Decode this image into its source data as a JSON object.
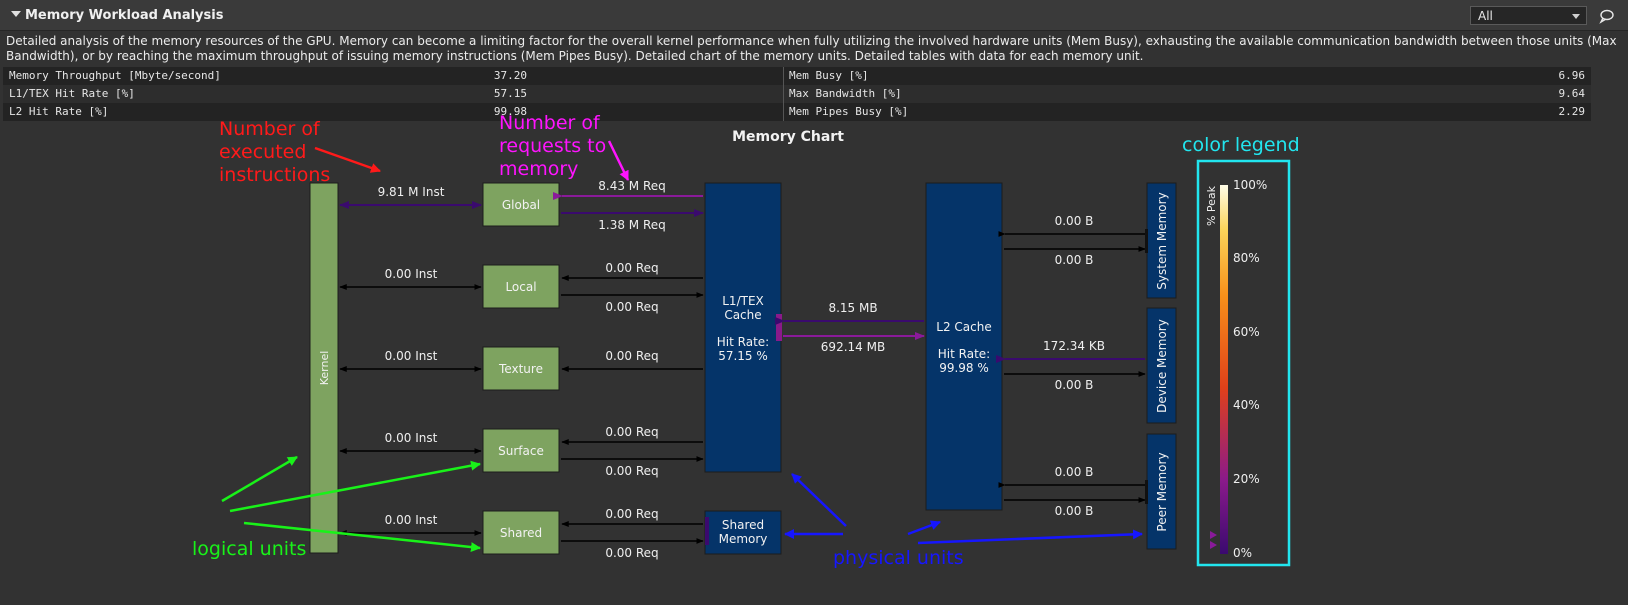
{
  "header": {
    "title": "Memory Workload Analysis",
    "filter_value": "All"
  },
  "description": "Detailed analysis of the memory resources of the GPU. Memory can become a limiting factor for the overall kernel performance when fully utilizing the involved hardware units (Mem Busy), exhausting the available communication bandwidth between those units (Max Bandwidth), or by reaching the maximum throughput of issuing memory instructions (Mem Pipes Busy). Detailed chart of the memory units. Detailed tables with data for each memory unit.",
  "metrics": [
    {
      "left_name": "Memory Throughput [Mbyte/second]",
      "left_value": "37.20",
      "right_name": "Mem Busy [%]",
      "right_value": "6.96"
    },
    {
      "left_name": "L1/TEX Hit Rate [%]",
      "left_value": "57.15",
      "right_name": "Max Bandwidth [%]",
      "right_value": "9.64"
    },
    {
      "left_name": "L2 Hit Rate [%]",
      "left_value": "99.98",
      "right_name": "Mem Pipes Busy [%]",
      "right_value": "2.29"
    }
  ],
  "chart": {
    "title": "Memory Chart",
    "kernel_label": "Kernel",
    "logical_units": [
      "Global",
      "Local",
      "Texture",
      "Surface",
      "Shared"
    ],
    "inst_labels": [
      "9.81 M Inst",
      "0.00 Inst",
      "0.00 Inst",
      "0.00 Inst",
      "0.00 Inst"
    ],
    "req_labels": {
      "global_top": "8.43 M Req",
      "global_bottom": "1.38 M Req",
      "local_top": "0.00 Req",
      "local_bottom": "0.00 Req",
      "texture": "0.00 Req",
      "surface_top": "0.00 Req",
      "surface_bottom": "0.00 Req",
      "shared_top": "0.00 Req",
      "shared_bottom": "0.00 Req"
    },
    "l1": {
      "name_line1": "L1/TEX",
      "name_line2": "Cache",
      "hit_label": "Hit Rate:",
      "hit_value": "57.15 %"
    },
    "shared_memory": {
      "line1": "Shared",
      "line2": "Memory"
    },
    "l1_l2": {
      "top": "8.15 MB",
      "bottom": "692.14 MB"
    },
    "l2": {
      "name": "L2 Cache",
      "hit_label": "Hit Rate:",
      "hit_value": "99.98 %"
    },
    "external": [
      {
        "name": "System Memory",
        "top": "0.00 B",
        "bottom": "0.00 B"
      },
      {
        "name": "Device Memory",
        "top": "172.34 KB",
        "bottom": "0.00 B"
      },
      {
        "name": "Peer Memory",
        "top": "0.00 B",
        "bottom": "0.00 B"
      }
    ],
    "legend": {
      "axis_label": "% Peak",
      "ticks": [
        "100%",
        "80%",
        "60%",
        "40%",
        "20%",
        "0%"
      ]
    }
  },
  "annotations": {
    "instructions": [
      "Number of",
      "executed",
      "instructions"
    ],
    "requests": [
      "Number of",
      "requests to",
      "memory"
    ],
    "legend": "color legend",
    "logical": "logical units",
    "physical": "physical units"
  },
  "colors": {
    "logical_fill": "#7ea360",
    "physical_fill": "#053469",
    "red": "#ff1a1a",
    "magenta": "#ff14ff",
    "cyan": "#22e6ef",
    "green": "#19f219",
    "blue": "#1616ff"
  }
}
